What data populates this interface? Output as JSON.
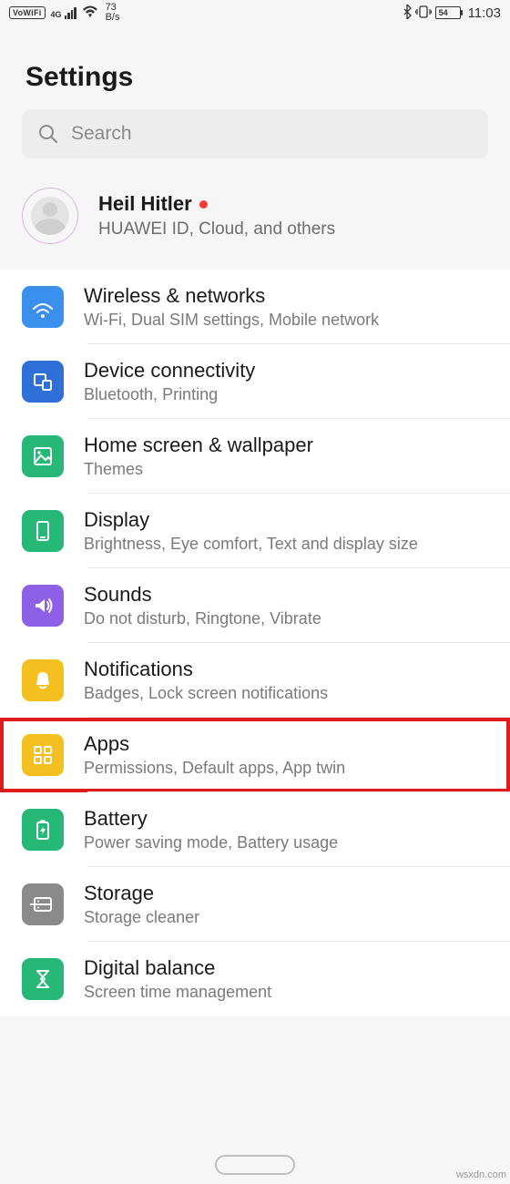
{
  "status": {
    "vowifi": "VoWiFi",
    "sig_gen": "4G",
    "speed_num": "73",
    "speed_unit": "B/s",
    "battery": "54",
    "time": "11:03"
  },
  "header": {
    "title": "Settings"
  },
  "search": {
    "placeholder": "Search"
  },
  "account": {
    "name": "Heil Hitler",
    "subtitle": "HUAWEI ID, Cloud, and others"
  },
  "items": [
    {
      "id": "wireless",
      "title": "Wireless & networks",
      "subtitle": "Wi-Fi, Dual SIM settings, Mobile network",
      "color": "#3b8fed",
      "highlight": false
    },
    {
      "id": "device-connectivity",
      "title": "Device connectivity",
      "subtitle": "Bluetooth, Printing",
      "color": "#2f6fd8",
      "highlight": false
    },
    {
      "id": "home-screen",
      "title": "Home screen & wallpaper",
      "subtitle": "Themes",
      "color": "#27b776",
      "highlight": false
    },
    {
      "id": "display",
      "title": "Display",
      "subtitle": "Brightness, Eye comfort, Text and display size",
      "color": "#27b776",
      "highlight": false
    },
    {
      "id": "sounds",
      "title": "Sounds",
      "subtitle": "Do not disturb, Ringtone, Vibrate",
      "color": "#8e60e8",
      "highlight": false
    },
    {
      "id": "notifications",
      "title": "Notifications",
      "subtitle": "Badges, Lock screen notifications",
      "color": "#f3c01f",
      "highlight": false
    },
    {
      "id": "apps",
      "title": "Apps",
      "subtitle": "Permissions, Default apps, App twin",
      "color": "#f3c01f",
      "highlight": true
    },
    {
      "id": "battery",
      "title": "Battery",
      "subtitle": "Power saving mode, Battery usage",
      "color": "#27b776",
      "highlight": false
    },
    {
      "id": "storage",
      "title": "Storage",
      "subtitle": "Storage cleaner",
      "color": "#8a8a8a",
      "highlight": false
    },
    {
      "id": "digital-balance",
      "title": "Digital balance",
      "subtitle": "Screen time management",
      "color": "#27b776",
      "highlight": false
    }
  ],
  "watermark": "wsxdn.com"
}
